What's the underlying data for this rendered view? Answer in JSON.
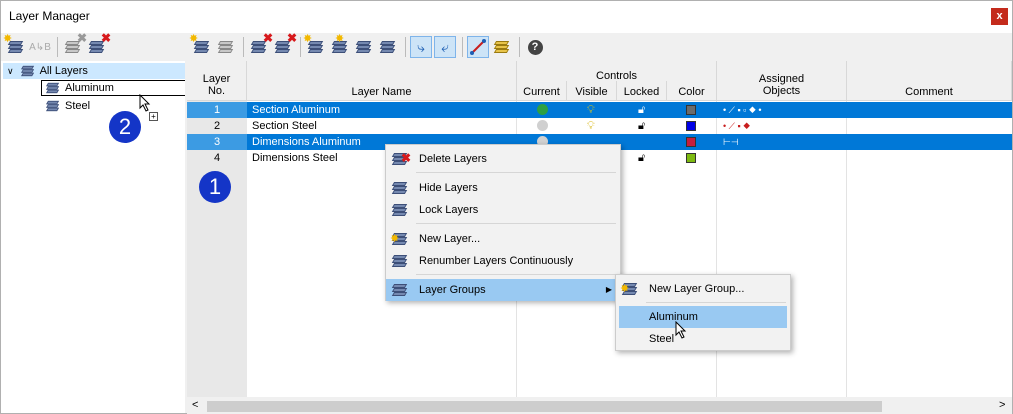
{
  "window": {
    "title": "Layer Manager",
    "close_glyph": "x"
  },
  "toolbar_icons": [
    "new-layer-icon",
    "renumber-icon",
    "delete-layer-icon",
    "delete-all-layers-icon",
    "new-layer-gold-icon",
    "layer-gold-2-icon",
    "layer-gray-1-icon",
    "layer-gray-2-icon",
    "select-in-layer-icon",
    "select-in-layer-2-icon",
    "assign-objects-icon",
    "layer-stack-icon",
    "help-icon"
  ],
  "tree": {
    "root": "All Layers",
    "groups": [
      "Aluminum",
      "Steel"
    ]
  },
  "grid": {
    "headers": {
      "layer_no": "Layer\nNo.",
      "layer_name": "Layer Name",
      "controls": "Controls",
      "current": "Current",
      "visible": "Visible",
      "locked": "Locked",
      "color": "Color",
      "assigned": "Assigned\nObjects",
      "comment": "Comment"
    },
    "rows": [
      {
        "no": "1",
        "name": "Section Aluminum",
        "selected": true,
        "color": "#6b6b6b"
      },
      {
        "no": "2",
        "name": "Section Steel",
        "selected": false,
        "color": "#0000e6"
      },
      {
        "no": "3",
        "name": "Dimensions Aluminum",
        "selected": true,
        "color": "#c81e3c"
      },
      {
        "no": "4",
        "name": "Dimensions Steel",
        "selected": false,
        "color": "#7dba11"
      }
    ]
  },
  "context_menu": {
    "items": [
      "Delete Layers",
      "Hide Layers",
      "Lock Layers",
      "New Layer...",
      "Renumber Layers Continuously",
      "Layer Groups"
    ]
  },
  "submenu": {
    "items": [
      "New Layer Group...",
      "Aluminum",
      "Steel"
    ]
  },
  "badges": [
    "1",
    "2"
  ]
}
